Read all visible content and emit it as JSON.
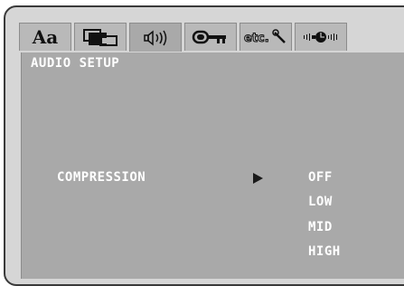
{
  "tabs": [
    {
      "id": "language",
      "icon": "language-aa-icon",
      "glyph": "Aa"
    },
    {
      "id": "display",
      "icon": "display-screens-icon"
    },
    {
      "id": "audio",
      "icon": "speaker-icon"
    },
    {
      "id": "parental",
      "icon": "key-icon"
    },
    {
      "id": "other",
      "icon": "etc-wrench-icon",
      "glyph": "etc."
    },
    {
      "id": "speaker-delay",
      "icon": "speaker-delay-icon"
    }
  ],
  "active_tab": "audio",
  "page_title": "AUDIO SETUP",
  "setting": {
    "label": "COMPRESSION",
    "options": [
      "OFF",
      "LOW",
      "MID",
      "HIGH"
    ],
    "selected": "OFF"
  },
  "colors": {
    "frame": "#d6d6d6",
    "tab": "#b9b9b9",
    "panel": "#a9a9a9",
    "text": "#ffffff"
  }
}
